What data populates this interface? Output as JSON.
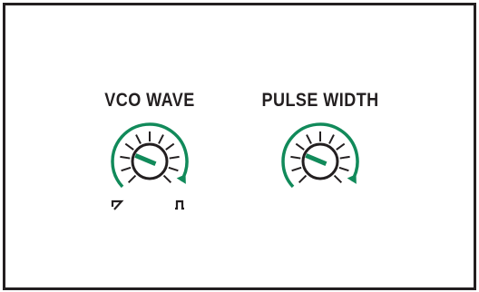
{
  "controls": {
    "vco_wave": {
      "label": "VCO WAVE",
      "position_fraction": 0.25,
      "range_icons": [
        "sawtooth-wave-icon",
        "square-wave-icon"
      ]
    },
    "pulse_width": {
      "label": "PULSE WIDTH",
      "position_fraction": 0.25
    }
  },
  "colors": {
    "accent": "#118a5a",
    "ink": "#231f20",
    "background": "#ffffff"
  }
}
